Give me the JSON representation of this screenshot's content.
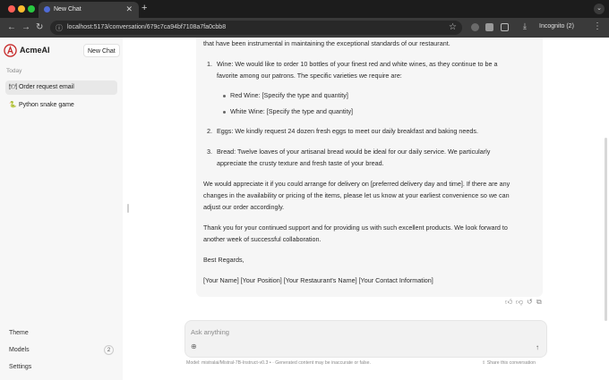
{
  "browser": {
    "tab_title": "New Chat",
    "tab_close": "✕",
    "new_tab": "+",
    "url": "localhost:5173/conversation/679c7ca94bf7108a7fa0cbb8",
    "incognito_label": "Incognito (2)",
    "back": "←",
    "forward": "→",
    "reload": "↻",
    "star": "☆",
    "menu": "⋮",
    "tab_menu": "⌄"
  },
  "sidebar": {
    "brand": "AcmeAI",
    "new_chat_label": "New Chat",
    "section_label": "Today",
    "items": [
      {
        "emoji": "🍽",
        "label": "Order request email"
      },
      {
        "emoji": "🐍",
        "label": "Python snake game"
      }
    ],
    "footer": {
      "theme": "Theme",
      "models": "Models",
      "models_count": "2",
      "settings": "Settings"
    }
  },
  "conversation": {
    "intro_tail": "that have been instrumental in maintaining the exceptional standards of our restaurant.",
    "item1_num": "1.",
    "item1_line1": "Wine: We would like to order 10 bottles of your finest red and white wines, as they continue to be a",
    "item1_line2": "favorite among our patrons. The specific varieties we require are:",
    "sub1": "Red Wine: [Specify the type and quantity]",
    "sub2": "White Wine: [Specify the type and quantity]",
    "item2_num": "2.",
    "item2_line1": "Eggs: We kindly request 24 dozen fresh eggs to meet our daily breakfast and baking needs.",
    "item3_num": "3.",
    "item3_line1": "Bread: Twelve loaves of your artisanal bread would be ideal for our daily service. We particularly",
    "item3_line2": "appreciate the crusty texture and fresh taste of your bread.",
    "para1_line1": "We would appreciate it if you could arrange for delivery on [preferred delivery day and time]. If there are any",
    "para1_line2": "changes in the availability or pricing of the items, please let us know at your earliest convenience so we can",
    "para1_line3": "adjust our order accordingly.",
    "para2_line1": "Thank you for your continued support and for providing us with such excellent products. We look forward to",
    "para2_line2": "another week of successful collaboration.",
    "regards": "Best Regards,",
    "signature": "[Your Name] [Your Position] [Your Restaurant's Name] [Your Contact Information]"
  },
  "composer": {
    "placeholder": "Ask anything",
    "footnote": "Model: mistralai/Mistral-7B-Instruct-v0.3 • · Generated content may be inaccurate or false.",
    "share": "Share this conversation"
  }
}
